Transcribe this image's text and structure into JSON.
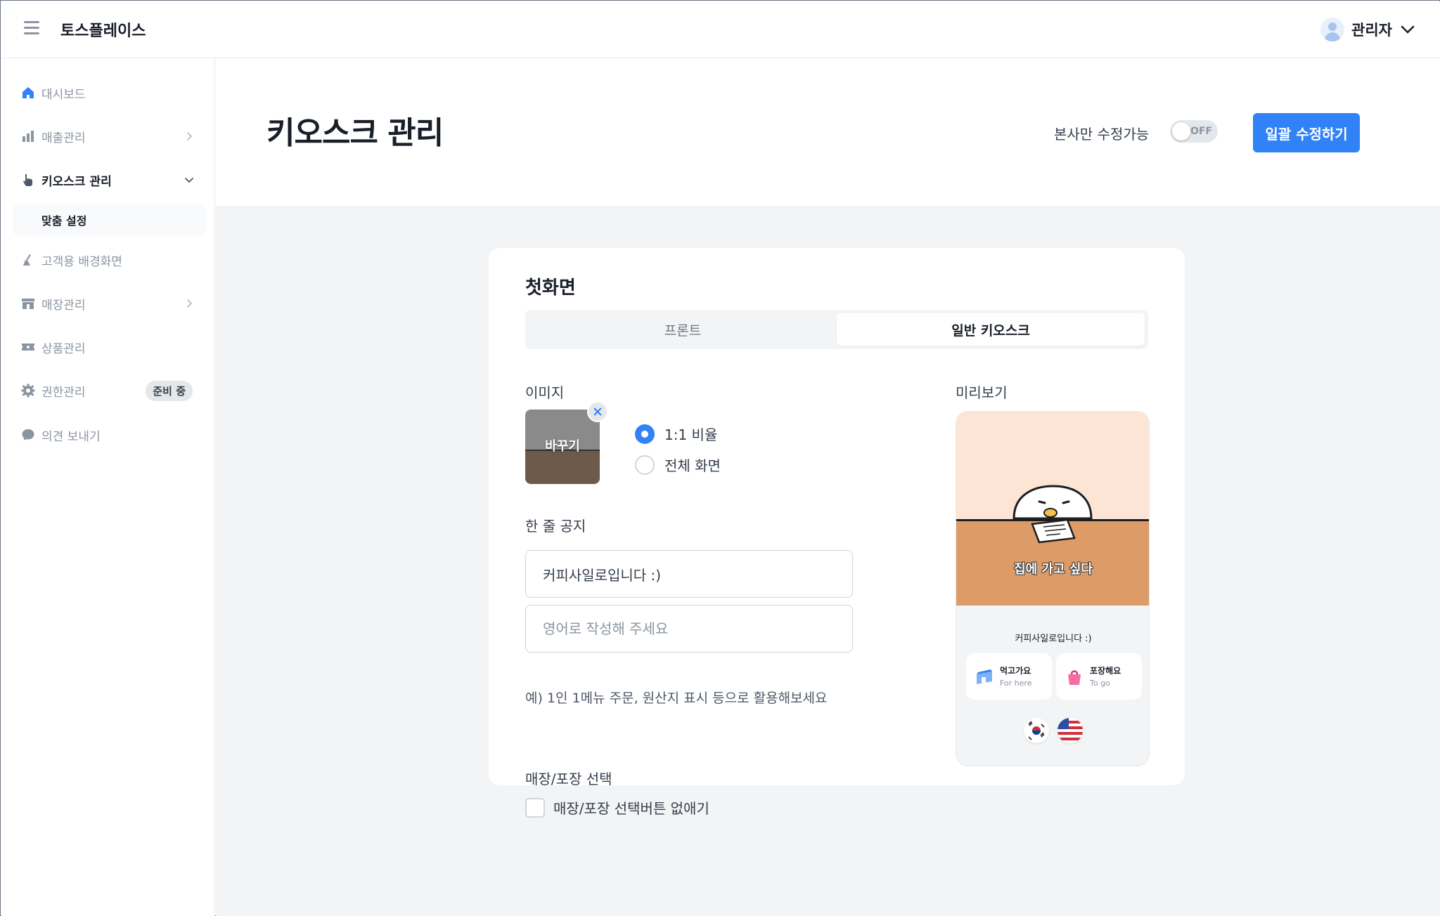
{
  "header": {
    "brand": "토스플레이스",
    "user_name": "관리자"
  },
  "sidebar": {
    "items": [
      {
        "label": "대시보드",
        "icon": "home-icon"
      },
      {
        "label": "매출관리",
        "icon": "bar-chart-icon"
      },
      {
        "label": "키오스크 관리",
        "icon": "pointer-hand-icon"
      },
      {
        "label": "맞춤 설정"
      },
      {
        "label": "고객용 배경화면",
        "icon": "brush-icon"
      },
      {
        "label": "매장관리",
        "icon": "store-icon"
      },
      {
        "label": "상품관리",
        "icon": "ticket-icon"
      },
      {
        "label": "권한관리",
        "icon": "gear-icon",
        "badge": "준비 중"
      },
      {
        "label": "의견 보내기",
        "icon": "chat-bubble-icon"
      }
    ]
  },
  "page": {
    "title": "키오스크 관리",
    "lock_label": "본사만 수정가능",
    "toggle_text": "OFF",
    "bulk_edit": "일괄 수정하기"
  },
  "card": {
    "title": "첫화면",
    "tabs": [
      "프론트",
      "일반 키오스크"
    ],
    "selected_tab": "일반 키오스크",
    "image_label": "이미지",
    "thumb_label": "바꾸기",
    "ratio_options": [
      "1:1 비율",
      "전체 화면"
    ],
    "ratio_selected": "1:1 비율",
    "notice_label": "한 줄 공지",
    "notice_value": "커피사일로입니다 :)",
    "notice_en_placeholder": "영어로 작성해 주세요",
    "notice_hint": "예) 1인 1메뉴 주문, 원산지 표시 등으로 활용해보세요",
    "dine_label": "매장/포장 선택",
    "dine_checkbox": "매장/포장 선택버튼 없애기",
    "preview_label": "미리보기"
  },
  "preview": {
    "caption": "집에 가고 싶다",
    "notice": "커피사일로입니다 :)",
    "for_here_ko": "먹고가요",
    "for_here_en": "For here",
    "to_go_ko": "포장해요",
    "to_go_en": "To go"
  },
  "colors": {
    "accent": "#3182f6",
    "page_bg": "#f2f4f6",
    "preview_sky": "#fde5d6",
    "preview_table": "#dc9b67"
  }
}
